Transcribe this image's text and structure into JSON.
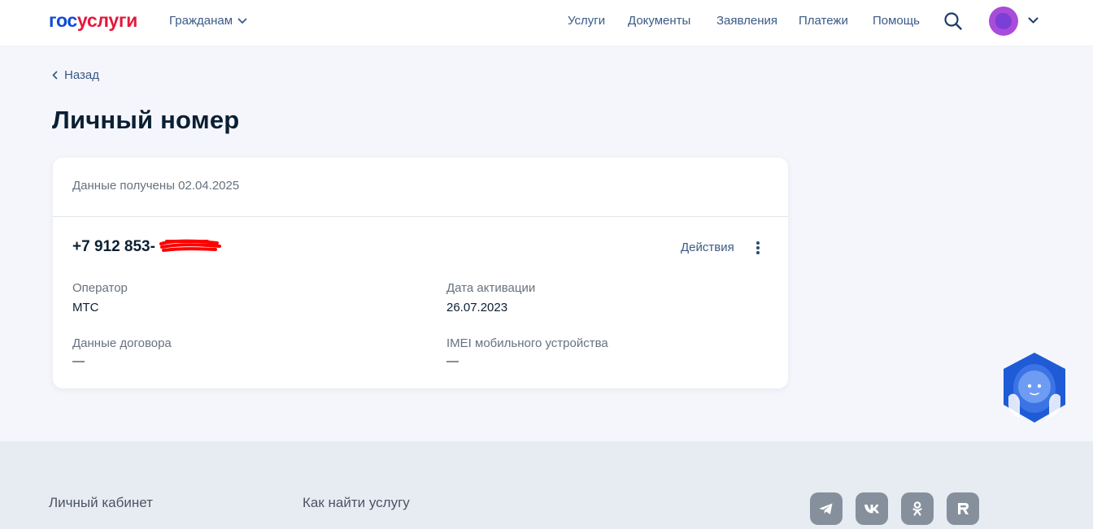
{
  "header": {
    "logo_part1": "гос",
    "logo_part2": "услуги",
    "audience_label": "Гражданам",
    "nav": [
      "Услуги",
      "Документы",
      "Заявления",
      "Платежи",
      "Помощь"
    ]
  },
  "back_label": "Назад",
  "page_title": "Личный номер",
  "card": {
    "received": "Данные получены 02.04.2025",
    "phone_visible": "+7 912 853-",
    "actions_label": "Действия",
    "fields": {
      "operator_label": "Оператор",
      "operator_value": "МТС",
      "activation_label": "Дата активации",
      "activation_value": "26.07.2023",
      "contract_label": "Данные договора",
      "contract_value": "—",
      "imei_label": "IMEI мобильного устройства",
      "imei_value": "—"
    }
  },
  "footer": {
    "links": [
      "Личный кабинет",
      "Как найти услугу"
    ],
    "social_icons": [
      "telegram-icon",
      "vk-icon",
      "odnoklassniki-icon",
      "rutube-icon"
    ]
  },
  "colors": {
    "brand_blue": "#0d4cd3",
    "brand_red": "#e5173a",
    "link": "#3a5a87",
    "text": "#0b1f33",
    "muted": "#66727f",
    "page_bg": "#f4f6fb",
    "footer_bg": "#e7ecf3",
    "redaction": "#ff0000"
  }
}
